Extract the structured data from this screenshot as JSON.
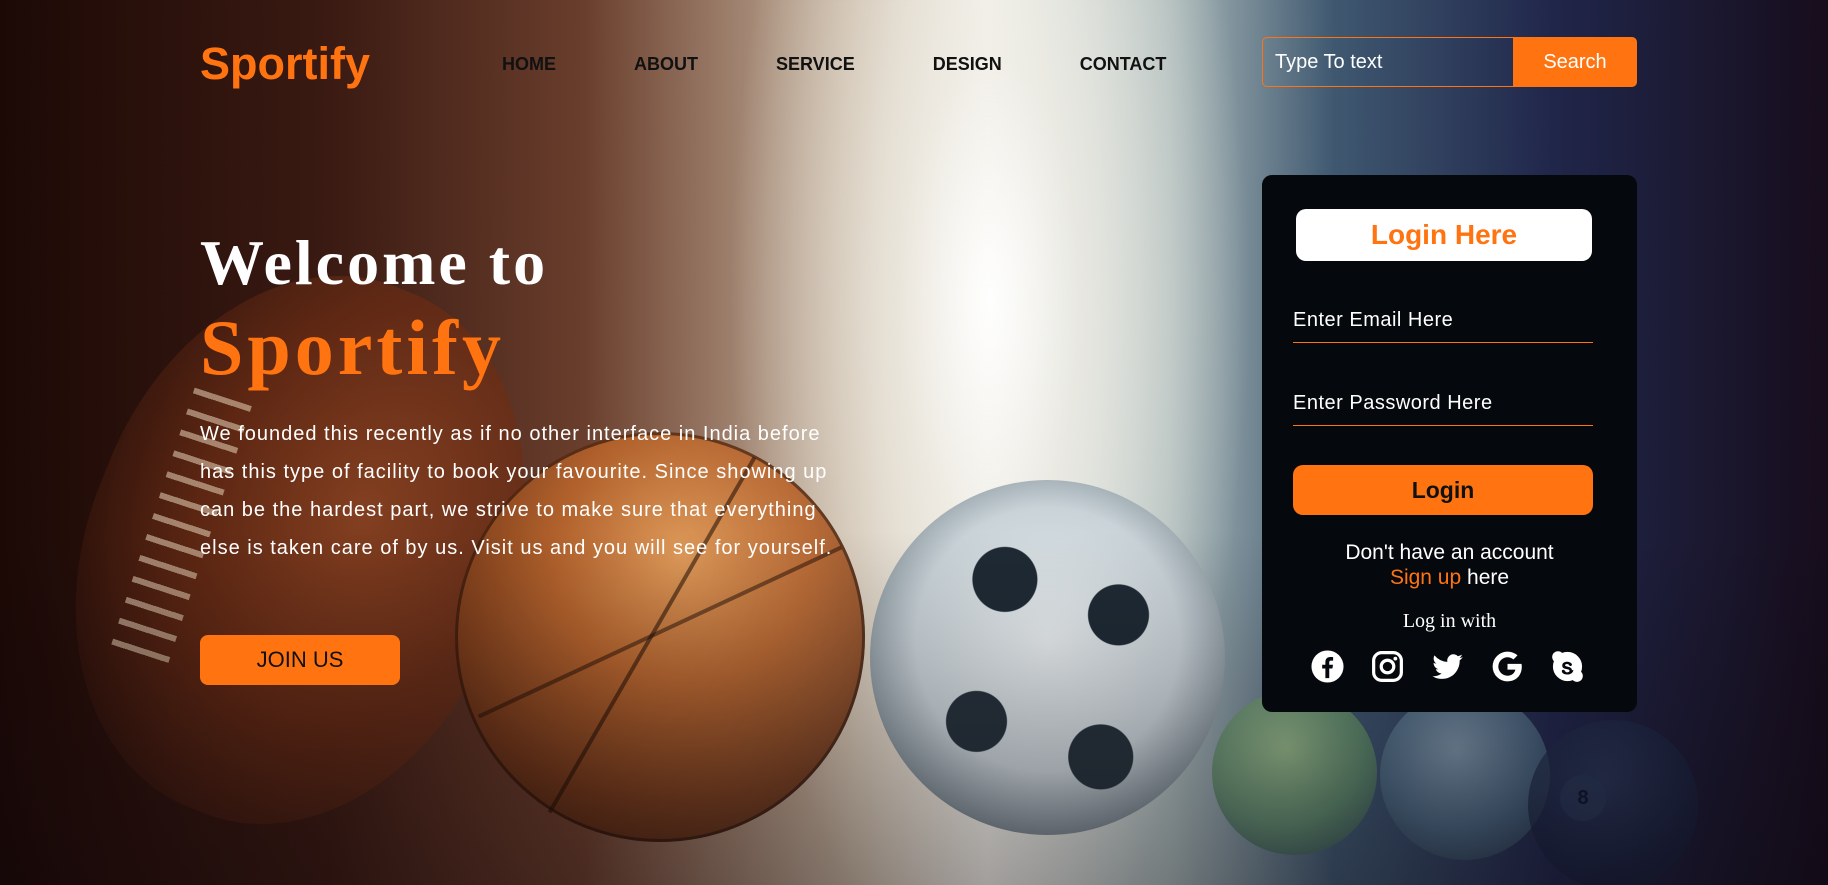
{
  "header": {
    "logo": "Sportify",
    "nav": [
      "HOME",
      "ABOUT",
      "SERVICE",
      "DESIGN",
      "CONTACT"
    ],
    "search_placeholder": "Type To text",
    "search_button": "Search"
  },
  "hero": {
    "welcome": "Welcome to",
    "brand": "Sportify",
    "description": "We founded this recently as if no other interface in India before has this type of facility to book your favourite. Since showing up can be the hardest part, we strive to make sure that everything else is taken care of by us. Visit us and you will see for yourself.",
    "join_button": "JOIN US"
  },
  "login": {
    "title": "Login Here",
    "email_placeholder": "Enter Email Here",
    "password_placeholder": "Enter Password Here",
    "login_button": "Login",
    "no_account": "Don't have an account",
    "signup_link": "Sign up",
    "signup_suffix": "here",
    "login_with": "Log in with",
    "socials": [
      "facebook-icon",
      "instagram-icon",
      "twitter-icon",
      "google-icon",
      "skype-icon"
    ]
  },
  "background": {
    "billiard_number": "8"
  },
  "colors": {
    "accent": "#ff7410",
    "card": "#05080c",
    "text_light": "#ffffff",
    "text_dark": "#111111"
  }
}
